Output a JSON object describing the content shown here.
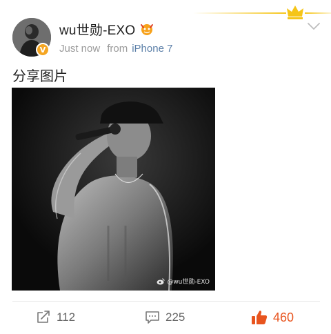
{
  "header": {
    "username": "wu世勋-EXO",
    "time": "Just now",
    "from_label": "from",
    "device": "iPhone 7",
    "verified_badge": "V"
  },
  "post": {
    "text": "分享图片",
    "watermark": "@wu世勋-EXO"
  },
  "actions": {
    "repost_count": "112",
    "comment_count": "225",
    "like_count": "460"
  },
  "colors": {
    "link_blue": "#5b7fa8",
    "like_orange": "#e8541e",
    "crown_gold": "#f5c518",
    "badge_orange": "#f5a623"
  },
  "icons": [
    "crown-icon",
    "fan-badge-icon",
    "chevron-down-icon",
    "repost-icon",
    "comment-icon",
    "thumbs-up-icon",
    "weibo-logo-icon"
  ]
}
